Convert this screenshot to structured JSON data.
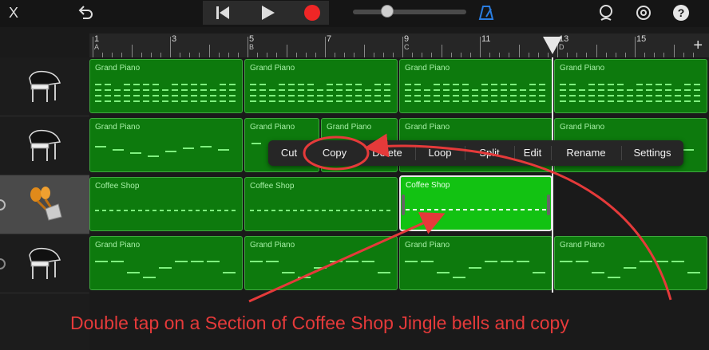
{
  "toolbar": {
    "close_icon": "close-icon",
    "undo_icon": "undo-icon",
    "rewind_icon": "skip-back-icon",
    "play_icon": "play-icon",
    "record_icon": "record-icon",
    "volume_level": 0.3,
    "metronome_icon": "metronome-icon",
    "loop_browser_icon": "loop-browser-icon",
    "settings_icon": "settings-icon",
    "help_icon": "help-icon",
    "close_glyph": "X",
    "help_glyph": "?"
  },
  "ruler": {
    "marks": [
      {
        "num": "1",
        "letter": "A"
      },
      {
        "num": "3",
        "letter": ""
      },
      {
        "num": "5",
        "letter": "B"
      },
      {
        "num": "7",
        "letter": ""
      },
      {
        "num": "9",
        "letter": "C"
      },
      {
        "num": "11",
        "letter": ""
      },
      {
        "num": "13",
        "letter": "D"
      },
      {
        "num": "15",
        "letter": ""
      }
    ],
    "add_label": "+"
  },
  "tracks": [
    {
      "instrument": "Grand Piano",
      "icon": "grand-piano-icon"
    },
    {
      "instrument": "Grand Piano",
      "icon": "grand-piano-icon"
    },
    {
      "instrument": "Coffee Shop",
      "icon": "percussion-icon",
      "selected": true
    },
    {
      "instrument": "Grand Piano",
      "icon": "grand-piano-icon"
    }
  ],
  "regions": {
    "track1": [
      "Grand Piano",
      "Grand Piano",
      "Grand Piano",
      "Grand Piano"
    ],
    "track2": [
      "Grand Piano",
      "Grand Piano",
      "Grand Piano",
      "Grand Piano",
      "Grand Piano"
    ],
    "track3": [
      "Coffee Shop",
      "Coffee Shop",
      "Coffee Shop"
    ],
    "track4": [
      "Grand Piano",
      "Grand Piano",
      "Grand Piano",
      "Grand Piano"
    ]
  },
  "context_menu": {
    "items": [
      "Cut",
      "Copy",
      "Delete",
      "Loop",
      "Split",
      "Edit",
      "Rename",
      "Settings"
    ]
  },
  "annotation": {
    "caption": "Double tap on a Section of Coffee Shop Jingle bells and copy",
    "color": "#e53a3a"
  },
  "colors": {
    "region_green": "#0d7a0d",
    "selected_region": "#12c212",
    "note_green": "#7ff07f"
  }
}
